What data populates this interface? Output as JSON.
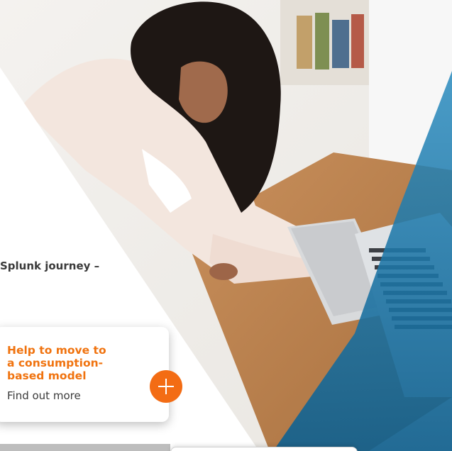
{
  "teaser": {
    "text": "Splunk journey –"
  },
  "card": {
    "title": "Help to move to a consumption-based model",
    "link_label": "Find out more"
  },
  "icons": {
    "expand": "plus-icon"
  },
  "colors": {
    "accent": "#f36c14",
    "title_orange": "#f0730f",
    "overlay_blue": "#1b7aa8",
    "text_dark": "#3a3a3a"
  }
}
